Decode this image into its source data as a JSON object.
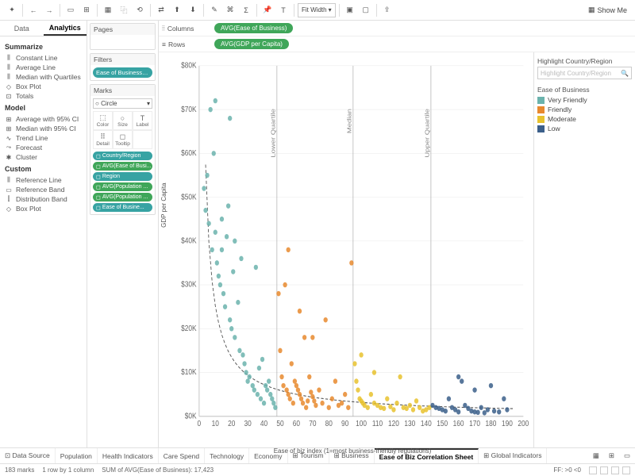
{
  "toolbar": {
    "fit_dropdown": "Fit Width",
    "showme": "Show Me"
  },
  "sidebar": {
    "tab_data": "Data",
    "tab_analytics": "Analytics",
    "summarize": {
      "head": "Summarize",
      "items": [
        "Constant Line",
        "Average Line",
        "Median with Quartiles",
        "Box Plot",
        "Totals"
      ]
    },
    "model": {
      "head": "Model",
      "items": [
        "Average with 95% CI",
        "Median with 95% CI",
        "Trend Line",
        "Forecast",
        "Cluster"
      ]
    },
    "custom": {
      "head": "Custom",
      "items": [
        "Reference Line",
        "Reference Band",
        "Distribution Band",
        "Box Plot"
      ]
    }
  },
  "panels": {
    "pages": "Pages",
    "filters": "Filters",
    "filter_pill": "Ease of Business (cl...",
    "marks": "Marks",
    "marks_type": "Circle",
    "mark_cells": {
      "color": "Color",
      "size": "Size",
      "label": "Label",
      "detail": "Detail",
      "tooltip": "Tooltip"
    },
    "pills": [
      {
        "cls": "mp-teal",
        "label": "Country/Region"
      },
      {
        "cls": "mp-green",
        "label": "AVG(Ease of Busi..."
      },
      {
        "cls": "mp-teal",
        "label": "Region"
      },
      {
        "cls": "mp-green",
        "label": "AVG(Population ..."
      },
      {
        "cls": "mp-green",
        "label": "AVG(Population ..."
      },
      {
        "cls": "mp-teal",
        "label": "Ease of Busine..."
      }
    ]
  },
  "shelves": {
    "columns": "Columns",
    "columns_pill": "AVG(Ease of Business)",
    "rows": "Rows",
    "rows_pill": "AVG(GDP per Capita)"
  },
  "right": {
    "highlight_head": "Highlight Country/Region",
    "highlight_placeholder": "Highlight Country/Region",
    "legend_head": "Ease of Business",
    "legend": [
      {
        "label": "Very Friendly",
        "color": "#6bb3ad"
      },
      {
        "label": "Friendly",
        "color": "#e8892e"
      },
      {
        "label": "Moderate",
        "color": "#e8c22e"
      },
      {
        "label": "Low",
        "color": "#3b5f8a"
      }
    ]
  },
  "chart_data": {
    "type": "scatter",
    "title": "",
    "xlabel": "Ease of biz index (1=most business-friendly regulations)",
    "ylabel": "GDP per Capita",
    "xlim": [
      0,
      200
    ],
    "ylim": [
      0,
      80000
    ],
    "x_ticks": [
      0,
      10,
      20,
      30,
      40,
      50,
      60,
      70,
      80,
      90,
      100,
      110,
      120,
      130,
      140,
      150,
      160,
      170,
      180,
      190,
      200
    ],
    "y_ticks": [
      "$0K",
      "$10K",
      "$20K",
      "$30K",
      "$40K",
      "$50K",
      "$60K",
      "$70K",
      "$80K"
    ],
    "reference_lines": [
      {
        "x": 48,
        "label": "Lower Quartile"
      },
      {
        "x": 95,
        "label": "Median"
      },
      {
        "x": 143,
        "label": "Upper Quartile"
      }
    ],
    "trend": "power-decay",
    "series": [
      {
        "name": "Very Friendly",
        "color": "#6bb3ad",
        "points": [
          [
            3,
            52000
          ],
          [
            4,
            47000
          ],
          [
            5,
            55000
          ],
          [
            6,
            44000
          ],
          [
            7,
            70000
          ],
          [
            8,
            38000
          ],
          [
            9,
            60000
          ],
          [
            10,
            42000
          ],
          [
            11,
            35000
          ],
          [
            12,
            32000
          ],
          [
            13,
            30000
          ],
          [
            14,
            45000
          ],
          [
            15,
            28000
          ],
          [
            16,
            25000
          ],
          [
            17,
            41000
          ],
          [
            18,
            48000
          ],
          [
            19,
            22000
          ],
          [
            20,
            20000
          ],
          [
            21,
            33000
          ],
          [
            22,
            18000
          ],
          [
            24,
            26000
          ],
          [
            25,
            15000
          ],
          [
            26,
            36000
          ],
          [
            27,
            14000
          ],
          [
            28,
            12000
          ],
          [
            29,
            10000
          ],
          [
            30,
            8000
          ],
          [
            31,
            9000
          ],
          [
            33,
            7000
          ],
          [
            34,
            6000
          ],
          [
            35,
            34000
          ],
          [
            36,
            5000
          ],
          [
            37,
            11000
          ],
          [
            38,
            4000
          ],
          [
            39,
            13000
          ],
          [
            40,
            3000
          ],
          [
            41,
            7000
          ],
          [
            42,
            6000
          ],
          [
            43,
            8000
          ],
          [
            44,
            5000
          ],
          [
            45,
            4000
          ],
          [
            46,
            3000
          ],
          [
            47,
            2000
          ],
          [
            10,
            72000
          ],
          [
            14,
            38000
          ],
          [
            19,
            68000
          ],
          [
            22,
            40000
          ]
        ]
      },
      {
        "name": "Friendly",
        "color": "#e8892e",
        "points": [
          [
            49,
            28000
          ],
          [
            50,
            15000
          ],
          [
            51,
            9000
          ],
          [
            52,
            7000
          ],
          [
            53,
            30000
          ],
          [
            54,
            6000
          ],
          [
            55,
            5000
          ],
          [
            56,
            4000
          ],
          [
            57,
            12000
          ],
          [
            58,
            3000
          ],
          [
            59,
            8000
          ],
          [
            60,
            7000
          ],
          [
            61,
            6000
          ],
          [
            62,
            5000
          ],
          [
            63,
            4000
          ],
          [
            64,
            3000
          ],
          [
            65,
            18000
          ],
          [
            66,
            2000
          ],
          [
            67,
            3500
          ],
          [
            68,
            9000
          ],
          [
            69,
            5500
          ],
          [
            70,
            4500
          ],
          [
            71,
            3500
          ],
          [
            72,
            2500
          ],
          [
            74,
            6000
          ],
          [
            76,
            3000
          ],
          [
            78,
            22000
          ],
          [
            80,
            2000
          ],
          [
            82,
            4000
          ],
          [
            84,
            8000
          ],
          [
            86,
            2500
          ],
          [
            88,
            3000
          ],
          [
            90,
            5000
          ],
          [
            92,
            2000
          ],
          [
            94,
            35000
          ],
          [
            55,
            38000
          ],
          [
            62,
            24000
          ],
          [
            70,
            18000
          ]
        ]
      },
      {
        "name": "Moderate",
        "color": "#e8c22e",
        "points": [
          [
            96,
            12000
          ],
          [
            97,
            8000
          ],
          [
            98,
            6000
          ],
          [
            99,
            4000
          ],
          [
            100,
            3500
          ],
          [
            101,
            3000
          ],
          [
            102,
            2500
          ],
          [
            104,
            2000
          ],
          [
            106,
            5000
          ],
          [
            108,
            3000
          ],
          [
            110,
            2500
          ],
          [
            112,
            2000
          ],
          [
            114,
            1800
          ],
          [
            116,
            4000
          ],
          [
            118,
            2200
          ],
          [
            120,
            1500
          ],
          [
            122,
            3000
          ],
          [
            124,
            9000
          ],
          [
            126,
            2000
          ],
          [
            128,
            1800
          ],
          [
            130,
            2500
          ],
          [
            132,
            1500
          ],
          [
            134,
            3500
          ],
          [
            136,
            2000
          ],
          [
            138,
            1200
          ],
          [
            140,
            1500
          ],
          [
            142,
            2000
          ],
          [
            100,
            14000
          ],
          [
            108,
            10000
          ]
        ]
      },
      {
        "name": "Low",
        "color": "#3b5f8a",
        "points": [
          [
            144,
            2500
          ],
          [
            146,
            2000
          ],
          [
            148,
            1800
          ],
          [
            150,
            1500
          ],
          [
            152,
            1200
          ],
          [
            154,
            4000
          ],
          [
            156,
            2000
          ],
          [
            158,
            1500
          ],
          [
            160,
            1000
          ],
          [
            162,
            8000
          ],
          [
            164,
            2500
          ],
          [
            166,
            1800
          ],
          [
            168,
            1200
          ],
          [
            170,
            1000
          ],
          [
            172,
            900
          ],
          [
            174,
            2000
          ],
          [
            176,
            800
          ],
          [
            178,
            1500
          ],
          [
            180,
            7000
          ],
          [
            182,
            1200
          ],
          [
            185,
            1000
          ],
          [
            188,
            4000
          ],
          [
            190,
            1500
          ],
          [
            160,
            9000
          ],
          [
            170,
            6000
          ]
        ]
      }
    ]
  },
  "bottom_tabs": [
    "Data Source",
    "Population",
    "Health Indicators",
    "Care Spend",
    "Technology",
    "Economy",
    "Tourism",
    "Business",
    "Ease of Biz Correlation Sheet",
    "Global Indicators"
  ],
  "bottom_active_index": 8,
  "status": {
    "marks": "183 marks",
    "rowcol": "1 row by 1 column",
    "sum": "SUM of AVG(Ease of Business): 17,423",
    "ff": "FF: >0 <0"
  }
}
